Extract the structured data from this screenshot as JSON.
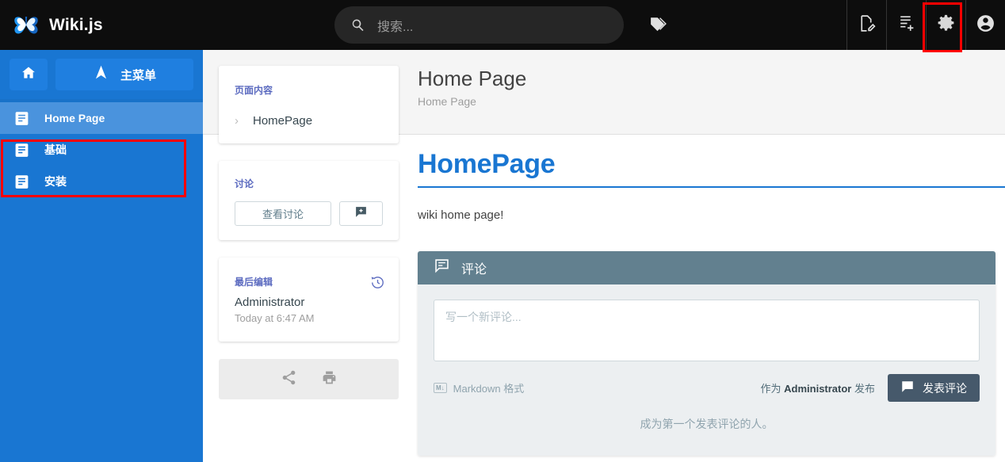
{
  "topbar": {
    "brand": "Wiki.js",
    "logo_icon": "butterfly-logo",
    "search": {
      "placeholder": "搜索...",
      "value": "",
      "icon": "search-icon"
    },
    "tags_icon": "tag-icon",
    "actions": [
      {
        "name": "edit-page",
        "icon": "page-edit-icon"
      },
      {
        "name": "new-page",
        "icon": "page-add-icon"
      },
      {
        "name": "admin-settings",
        "icon": "gear-icon"
      },
      {
        "name": "account",
        "icon": "account-circle-icon"
      }
    ]
  },
  "sidebar": {
    "home_icon": "home-icon",
    "main_menu_label": "主菜单",
    "main_menu_icon": "navigation-icon",
    "items": [
      {
        "label": "Home Page",
        "icon": "page-icon",
        "active": true
      },
      {
        "label": "基础",
        "icon": "page-icon",
        "active": false
      },
      {
        "label": "安装",
        "icon": "page-icon",
        "active": false
      }
    ]
  },
  "page_header": {
    "title": "Home Page",
    "subtitle": "Home Page"
  },
  "toc_card": {
    "label": "页面内容",
    "items": [
      {
        "chevron": "›",
        "label": "HomePage"
      }
    ]
  },
  "discussion_card": {
    "label": "讨论",
    "view_label": "查看讨论",
    "new_icon": "comment-plus-icon"
  },
  "edit_card": {
    "label": "最后编辑",
    "author": "Administrator",
    "date": "Today at 6:47 AM",
    "history_icon": "history-icon"
  },
  "tools_card": {
    "share_icon": "share-icon",
    "print_icon": "print-icon"
  },
  "article": {
    "heading": "HomePage",
    "body": "wiki home page!"
  },
  "comments": {
    "header_label": "评论",
    "header_icon": "comment-text-icon",
    "input_placeholder": "写一个新评论...",
    "markdown_note": "Markdown 格式",
    "markdown_badge": "M↓",
    "post_as_prefix": "作为 ",
    "post_as_user": "Administrator",
    "post_as_suffix": " 发布",
    "post_button": "发表评论",
    "post_button_icon": "comment-icon",
    "empty_message": "成为第一个发表评论的人。"
  },
  "annotations": [
    {
      "name": "annotation-sidebar-pages",
      "color": "#ff0000"
    },
    {
      "name": "annotation-admin-gear",
      "color": "#ff0000"
    }
  ]
}
